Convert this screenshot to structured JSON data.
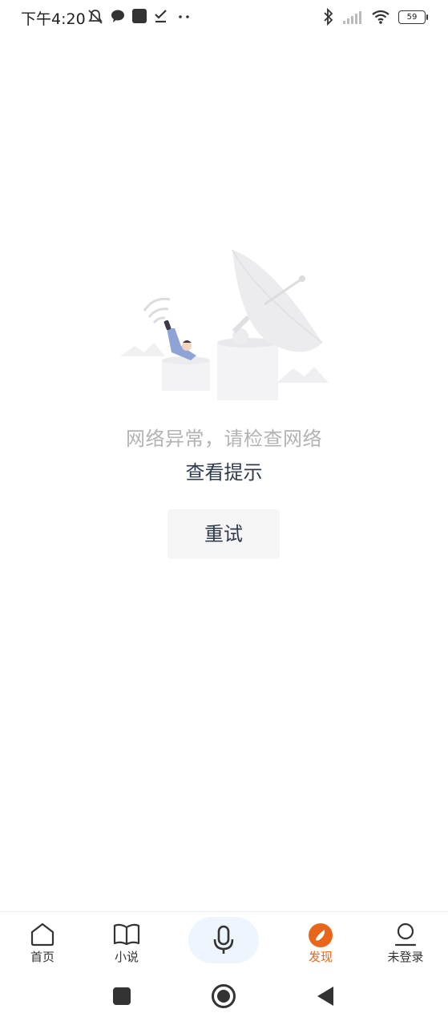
{
  "status_bar": {
    "time": "下午4:20",
    "battery_level": "59"
  },
  "error": {
    "message": "网络异常，请检查网络",
    "hint_link": "查看提示",
    "retry_label": "重试"
  },
  "tabs": [
    {
      "label": "首页",
      "icon": "home-icon",
      "active": false
    },
    {
      "label": "小说",
      "icon": "book-icon",
      "active": false
    },
    {
      "label": "",
      "icon": "microphone-icon",
      "active": false
    },
    {
      "label": "发现",
      "icon": "discover-compass-icon",
      "active": true
    },
    {
      "label": "未登录",
      "icon": "user-icon",
      "active": false
    }
  ],
  "colors": {
    "accent": "#e8651a",
    "text_dark": "#2f3a4d",
    "text_muted": "#b3b3b3"
  }
}
